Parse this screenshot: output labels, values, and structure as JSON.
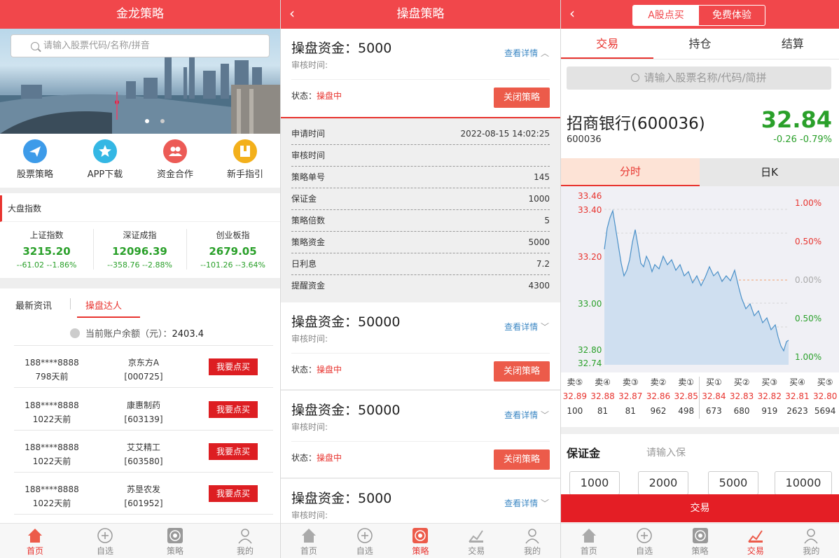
{
  "s1": {
    "title": "金龙策略",
    "search_placeholder": "请输入股票代码/名称/拼音",
    "quick": [
      {
        "label": "股票策略",
        "color": "#3d9be9"
      },
      {
        "label": "APP下载",
        "color": "#34b7e4"
      },
      {
        "label": "资金合作",
        "color": "#ec5b56"
      },
      {
        "label": "新手指引",
        "color": "#f3b01b"
      }
    ],
    "market_title": "大盘指数",
    "indices": [
      {
        "name": "上证指数",
        "value": "3215.20",
        "change": "--61.02 --1.86%"
      },
      {
        "name": "深证成指",
        "value": "12096.39",
        "change": "--358.76 --2.88%"
      },
      {
        "name": "创业板指",
        "value": "2679.05",
        "change": "--101.26 --3.64%"
      }
    ],
    "tabs": [
      "最新资讯",
      "操盘达人"
    ],
    "balance_label": "当前账户余额（元）：",
    "balance_value": "2403.4",
    "rows": [
      {
        "phone": "188****8888",
        "time": "798天前",
        "stock": "京东方A",
        "code": "[000725]",
        "btn": "我要点买"
      },
      {
        "phone": "188****8888",
        "time": "1022天前",
        "stock": "康惠制药",
        "code": "[603139]",
        "btn": "我要点买"
      },
      {
        "phone": "188****8888",
        "time": "1022天前",
        "stock": "艾艾精工",
        "code": "[603580]",
        "btn": "我要点买"
      },
      {
        "phone": "188****8888",
        "time": "1022天前",
        "stock": "苏垦农发",
        "code": "[601952]",
        "btn": "我要点买"
      }
    ],
    "tabbar": [
      "首页",
      "自选",
      "策略",
      "我的"
    ]
  },
  "s2": {
    "title": "操盘策略",
    "cards": [
      {
        "title": "操盘资金：5000",
        "sub": "审核时间:",
        "details": "查看详情",
        "status_label": "状态：",
        "status": "操盘中",
        "btn": "关闭策略"
      },
      {
        "title": "操盘资金：50000",
        "sub": "审核时间:",
        "details": "查看详情",
        "status_label": "状态：",
        "status": "操盘中",
        "btn": "关闭策略"
      },
      {
        "title": "操盘资金：50000",
        "sub": "审核时间:",
        "details": "查看详情",
        "status_label": "状态：",
        "status": "操盘中",
        "btn": "关闭策略"
      },
      {
        "title": "操盘资金：5000",
        "sub": "审核时间:",
        "details": "查看详情"
      }
    ],
    "detail_rows": [
      {
        "k": "申请时间",
        "v": "2022-08-15 14:02:25"
      },
      {
        "k": "审核时间",
        "v": ""
      },
      {
        "k": "策略单号",
        "v": "145"
      },
      {
        "k": "保证金",
        "v": "1000"
      },
      {
        "k": "策略倍数",
        "v": "5"
      },
      {
        "k": "策略资金",
        "v": "5000"
      },
      {
        "k": "日利息",
        "v": "7.2"
      },
      {
        "k": "提醒资金",
        "v": "4300"
      }
    ],
    "tabbar": [
      "首页",
      "自选",
      "策略",
      "交易",
      "我的"
    ]
  },
  "s3": {
    "seg": [
      "A股点买",
      "免费体验"
    ],
    "tabs": [
      "交易",
      "持仓",
      "结算"
    ],
    "search_placeholder": "请输入股票名称/代码/简拼",
    "stock_name": "招商银行(600036)",
    "stock_code": "600036",
    "price": "32.84",
    "change": "-0.26",
    "change_pct": "-0.79%",
    "chart_tabs": [
      "分时",
      "日K"
    ],
    "y_labels": [
      "33.46",
      "33.40",
      "33.20",
      "33.00",
      "32.80",
      "32.74"
    ],
    "pct_labels": [
      "1.00%",
      "0.50%",
      "0.00%",
      "0.50%",
      "1.00%"
    ],
    "order_book": {
      "labels": [
        "卖⑤",
        "卖④",
        "卖③",
        "卖②",
        "卖①",
        "买①",
        "买②",
        "买③",
        "买④",
        "买⑤"
      ],
      "prices": [
        "32.89",
        "32.88",
        "32.87",
        "32.86",
        "32.85",
        "32.84",
        "32.83",
        "32.82",
        "32.81",
        "32.80"
      ],
      "volumes": [
        "100",
        "81",
        "81",
        "962",
        "498",
        "673",
        "680",
        "919",
        "2623",
        "5694"
      ]
    },
    "margin_label": "保证金",
    "margin_placeholder": "请输入保",
    "amounts": [
      "1000",
      "2000",
      "5000",
      "10000"
    ],
    "trade_btn": "交易",
    "tabbar": [
      "首页",
      "自选",
      "策略",
      "交易",
      "我的"
    ]
  },
  "colors": {
    "red": "#f1474b",
    "green": "#2aa02a",
    "blue_line": "#4a90c8"
  }
}
